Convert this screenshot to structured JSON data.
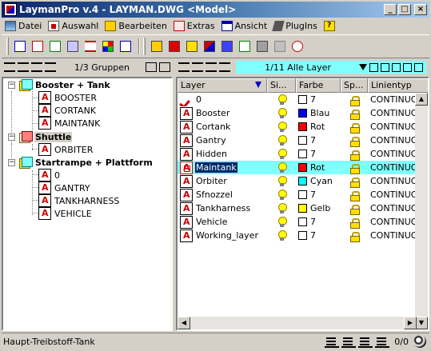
{
  "window": {
    "title": "LaymanPro v.4 - LAYMAN.DWG <Model>",
    "minimize": "_",
    "maximize": "□",
    "close": "×"
  },
  "menubar": {
    "items": [
      {
        "label": "Datei",
        "icon": "file-icon"
      },
      {
        "label": "Auswahl",
        "icon": "select-icon"
      },
      {
        "label": "Bearbeiten",
        "icon": "edit-icon"
      },
      {
        "label": "Extras",
        "icon": "extras-icon"
      },
      {
        "label": "Ansicht",
        "icon": "view-icon"
      },
      {
        "label": "PlugIns",
        "icon": "plugin-icon"
      },
      {
        "label": "?",
        "icon": "help-icon"
      }
    ]
  },
  "left_pane": {
    "header_count": "1/3 Gruppen",
    "tree": [
      {
        "label": "Booster + Tank",
        "type": "group",
        "expanded": true,
        "children": [
          "BOOSTER",
          "CORTANK",
          "MAINTANK"
        ]
      },
      {
        "label": "Shuttle",
        "type": "group",
        "expanded": true,
        "selected": true,
        "children": [
          "ORBITER"
        ]
      },
      {
        "label": "Startrampe + Plattform",
        "type": "group",
        "expanded": true,
        "children": [
          "0",
          "GANTRY",
          "TANKHARNESS",
          "VEHICLE"
        ]
      }
    ]
  },
  "right_pane": {
    "header_count": "1/11 Alle Layer",
    "columns": [
      "Layer",
      "Si...",
      "Farbe",
      "Sp...",
      "Linientyp"
    ],
    "rows": [
      {
        "name": "0",
        "current": true,
        "color_name": "7",
        "color_hex": "#ffffff",
        "linetype": "CONTINUOUS"
      },
      {
        "name": "Booster",
        "color_name": "Blau",
        "color_hex": "#0000ff",
        "linetype": "CONTINUOUS"
      },
      {
        "name": "Cortank",
        "color_name": "Rot",
        "color_hex": "#ff0000",
        "linetype": "CONTINUOUS"
      },
      {
        "name": "Gantry",
        "color_name": "7",
        "color_hex": "#ffffff",
        "linetype": "CONTINUOUS"
      },
      {
        "name": "Hidden",
        "color_name": "7",
        "color_hex": "#ffffff",
        "linetype": "CONTINUOUS"
      },
      {
        "name": "Maintank",
        "selected": true,
        "color_name": "Rot",
        "color_hex": "#ff0000",
        "linetype": "CONTINUOUS"
      },
      {
        "name": "Orbiter",
        "color_name": "Cyan",
        "color_hex": "#00ffff",
        "linetype": "CONTINUOUS"
      },
      {
        "name": "Sfnozzel",
        "color_name": "7",
        "color_hex": "#ffffff",
        "linetype": "CONTINUOUS"
      },
      {
        "name": "Tankharness",
        "color_name": "Gelb",
        "color_hex": "#ffff00",
        "linetype": "CONTINUOUS"
      },
      {
        "name": "Vehicle",
        "color_name": "7",
        "color_hex": "#ffffff",
        "linetype": "CONTINUOUS"
      },
      {
        "name": "Working_layer",
        "color_name": "7",
        "color_hex": "#ffffff",
        "linetype": "CONTINUOUS"
      }
    ]
  },
  "statusbar": {
    "text": "Haupt-Treibstoff-Tank",
    "counter": "0/0"
  }
}
